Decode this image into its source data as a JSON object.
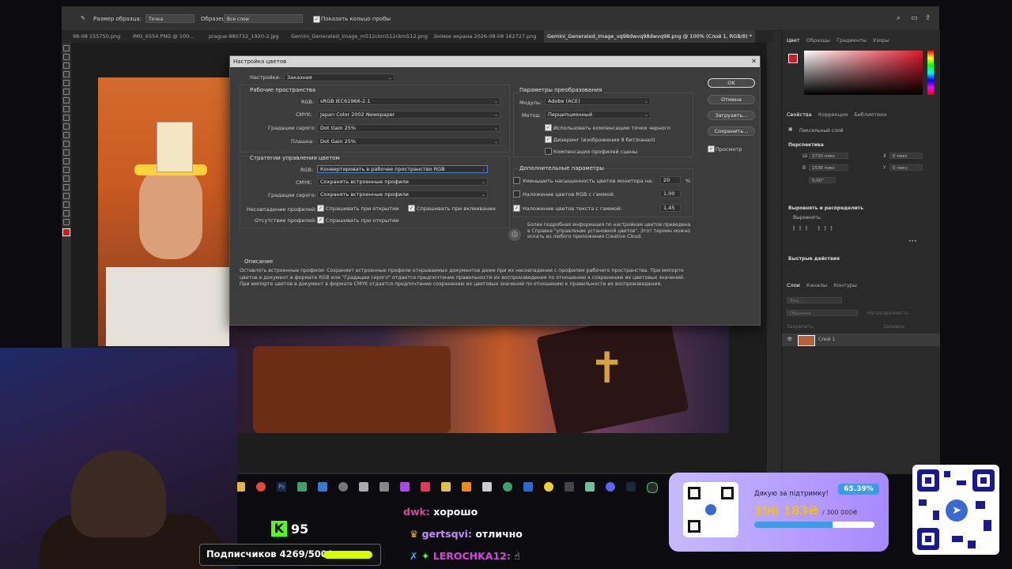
{
  "options_bar": {
    "sample_size_label": "Размер образца:",
    "sample_size_value": "Точка",
    "sample_label": "Образец:",
    "sample_value": "Все слои",
    "show_ring_label": "Показать кольцо пробы"
  },
  "doc_tabs": [
    "98-08 155750.png",
    "IMG_6554.PNG @ 100...",
    "prague-980732_1920-2.jpg",
    "Gemini_Generated_Image_m512ckm512ckm512.png",
    "Знімок екрана 2026-08-08 162727.png",
    "Gemini_Generated_Image_vq98dwvq98dwvq98.png @ 100% (Слой 1, RGB/8) *"
  ],
  "dialog": {
    "title": "Настройка цветов",
    "settings_label": "Настройки:",
    "settings_value": "Заказная",
    "working_spaces_title": "Рабочие пространства",
    "ws": {
      "rgb_label": "RGB:",
      "rgb_value": "sRGB IEC61966-2.1",
      "cmyk_label": "CMYK:",
      "cmyk_value": "Japan Color 2002 Newspaper",
      "gray_label": "Градации серого:",
      "gray_value": "Dot Gain 25%",
      "spot_label": "Плашка:",
      "spot_value": "Dot Gain 25%"
    },
    "policies_title": "Стратегии управления цветом",
    "policies": {
      "rgb_label": "RGB:",
      "rgb_value": "Конвертировать в рабочее пространство RGB",
      "cmyk_label": "CMYK:",
      "cmyk_value": "Сохранять встроенные профили",
      "gray_label": "Градации серого:",
      "gray_value": "Сохранять встроенные профили",
      "mismatch_label": "Несовпадение профилей:",
      "ask_open": "Спрашивать при открытии",
      "ask_paste": "Спрашивать при вклеивании",
      "missing_label": "Отсутствие профилей:",
      "ask_open2": "Спрашивать при открытии"
    },
    "conversion_title": "Параметры преобразования",
    "conversion": {
      "engine_label": "Модуль:",
      "engine_value": "Adobe (ACE)",
      "intent_label": "Метод:",
      "intent_value": "Перцепционный",
      "bpc": "Использовать компенсацию точки черного",
      "dither": "Дизеринг (изображения 8 бит/канал)",
      "scene": "Компенсация профилей сцены"
    },
    "advanced_title": "Дополнительные параметры",
    "advanced": {
      "desaturate": "Уменьшить насыщенность цветов монитора на:",
      "desaturate_value": "20",
      "desaturate_unit": "%",
      "blend_rgb": "Наложение цветов RGB с гаммой:",
      "blend_rgb_value": "1,00",
      "blend_text": "Наложение цветов текста с гаммой:",
      "blend_text_value": "1,45"
    },
    "info_text": "Более подробная информация по настройкам цветов приведена в Справке \"управление установкой цветов\". Этот термин можно искать из любого приложения Creative Cloud.",
    "description_title": "Описание",
    "description_text": "Оставлять встроенные профили: Сохраняет встроенные профили открываемых документов даже при их несовпадении с профилем рабочего пространства. При импорте цветов в документ в формате RGB или \"Градации серого\" отдается предпочтение правильности их воспроизведения по отношению к сохранению их цветовых значений. При импорте цветов в документ в формате CMYK отдается предпочтение сохранению их цветовых значений по отношению к правильности их воспроизведения.",
    "buttons": {
      "ok": "OK",
      "cancel": "Отмена",
      "load": "Загрузить...",
      "save": "Сохранить..."
    },
    "preview_label": "Просмотр"
  },
  "right_panel": {
    "top_tabs": [
      "Цвет",
      "Образцы",
      "Градиенты",
      "Узоры"
    ],
    "mid_tabs": [
      "Свойства",
      "Коррекция",
      "Библиотеки"
    ],
    "pixel_layer": "Пиксельный слой",
    "transform_title": "Перспектива",
    "w_label": "Ш",
    "w_value": "2730 пикс",
    "h_label": "В",
    "h_value": "1536 пикс",
    "x_label": "X",
    "x_value": "0 пикс",
    "y_label": "Y",
    "y_value": "0 пикс",
    "angle_value": "0,00°",
    "align_title": "Выровнять и распределить",
    "align_sub": "Выровнять:",
    "quick_title": "Быстрые действия",
    "layer_tabs": [
      "Слои",
      "Каналы",
      "Контуры"
    ],
    "layer_search": "Вид",
    "blend_mode": "Обычные",
    "opacity_label": "Непрозрачность:",
    "lock_label": "Закрепить:",
    "fill_label": "Заливка:",
    "layer_name": "Слой 1"
  },
  "overlay": {
    "kick_count": "95",
    "subs_text": "Подписчиков 4269/5000",
    "chat": [
      {
        "user": "dwk:",
        "msg": "хорошо",
        "color": "#e040a0"
      },
      {
        "user": "gertsqvi:",
        "msg": "отлично",
        "color": "#c78bff"
      },
      {
        "user": "LEROCHKA12:",
        "msg": "☝",
        "color": "#e040e0"
      }
    ],
    "donate_title": "Дякую за підтримку!",
    "donate_amount": "196 183₴",
    "donate_goal": "/ 300 000₴",
    "donate_percent": "65.39%",
    "donate_progress": 0.654
  },
  "colors": {
    "accent": "#4a7ed0",
    "kick_green": "#53fc18",
    "subs_bar": "#d4ff00",
    "donate_bar": "#3a9de6"
  }
}
